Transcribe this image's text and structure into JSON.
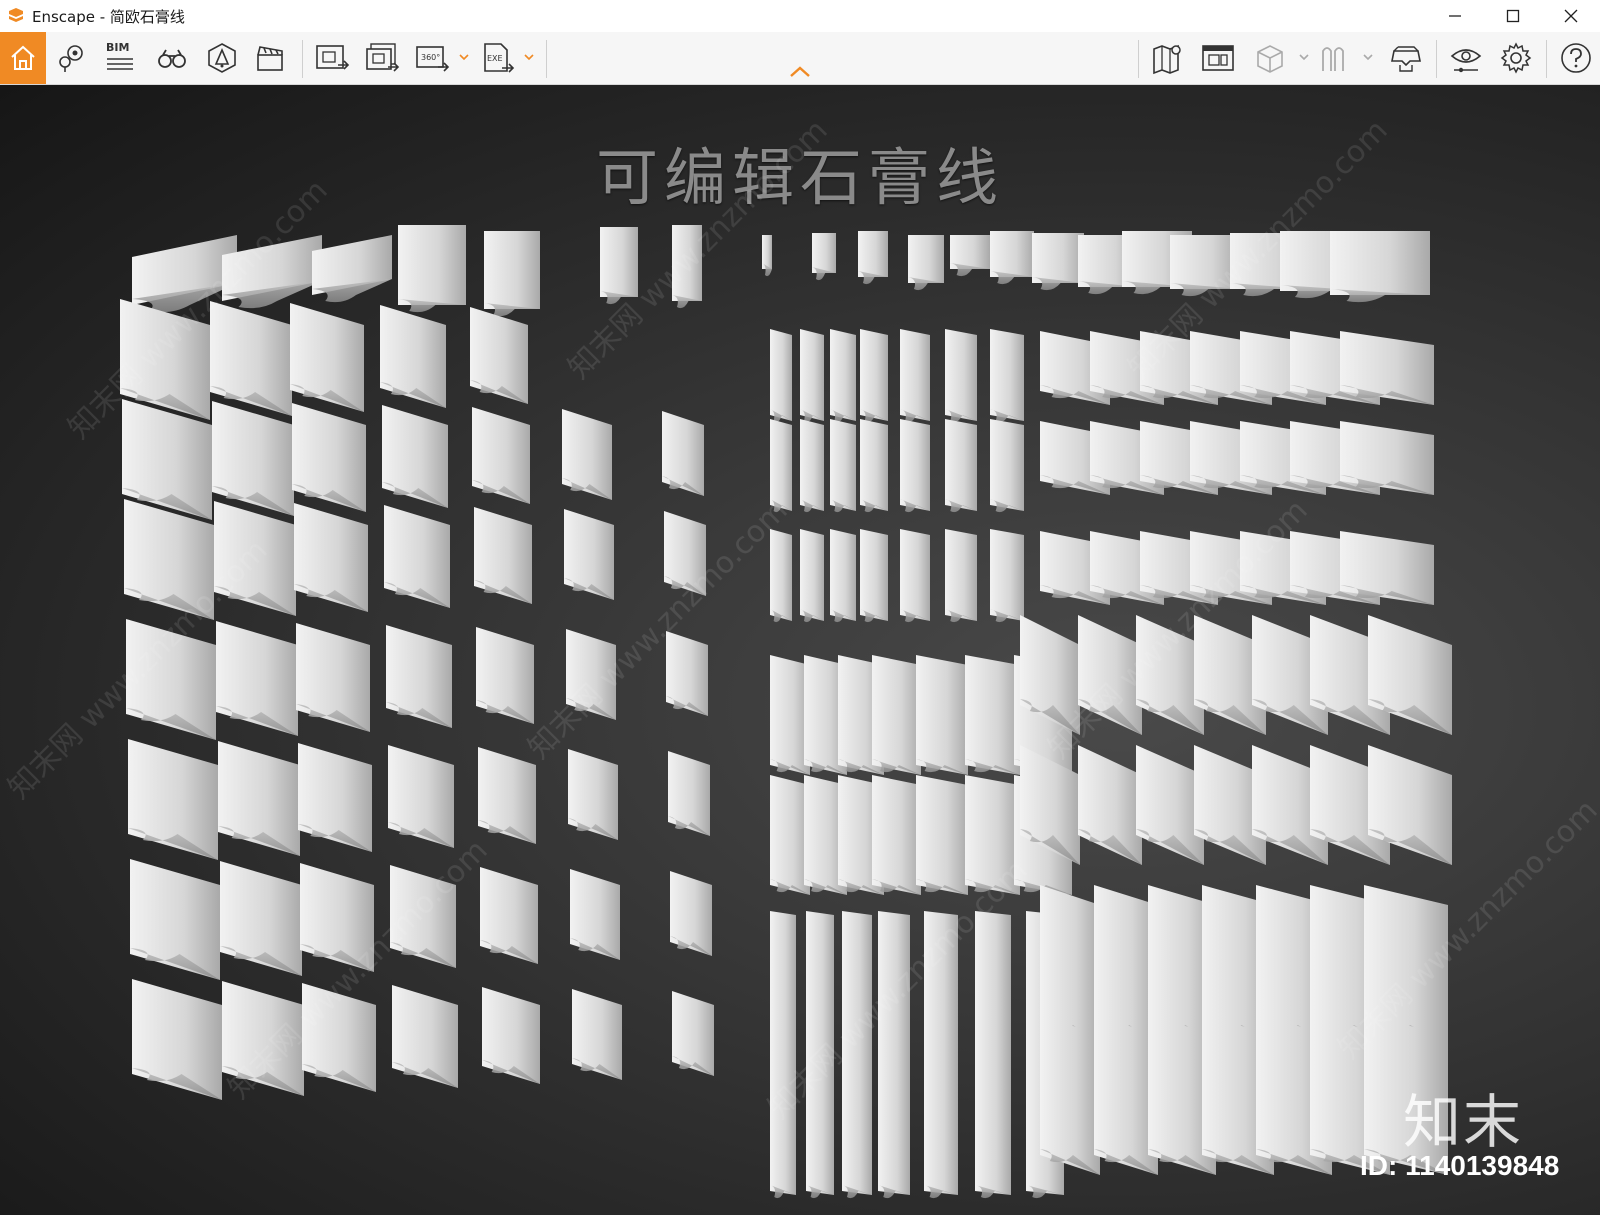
{
  "window": {
    "title": "Enscape - 简欧石膏线",
    "controls": {
      "minimize": "minimize-icon",
      "maximize": "maximize-icon",
      "close": "close-icon"
    }
  },
  "toolbar": {
    "accent_color": "#f08a24",
    "bim_label": "BIM",
    "buttons": [
      {
        "name": "home-icon"
      },
      {
        "name": "location-pins-icon"
      },
      {
        "name": "bim-icon"
      },
      {
        "name": "binoculars-icon"
      },
      {
        "name": "asset-library-icon"
      },
      {
        "name": "clapperboard-icon"
      },
      {
        "name": "render-screenshot-icon"
      },
      {
        "name": "batch-render-icon"
      },
      {
        "name": "panorama-360-icon"
      },
      {
        "name": "export-exe-icon"
      },
      {
        "name": "map-icon"
      },
      {
        "name": "visual-settings-icon"
      },
      {
        "name": "cube-icon"
      },
      {
        "name": "materials-icon"
      },
      {
        "name": "vr-headset-icon"
      },
      {
        "name": "eye-icon"
      },
      {
        "name": "gear-icon"
      },
      {
        "name": "help-icon"
      }
    ]
  },
  "viewport": {
    "scene_title": "可编辑石膏线",
    "watermark": "知末网 www.znzmo.com",
    "logo_text": "知末",
    "id_text": "ID: 1140139848"
  }
}
